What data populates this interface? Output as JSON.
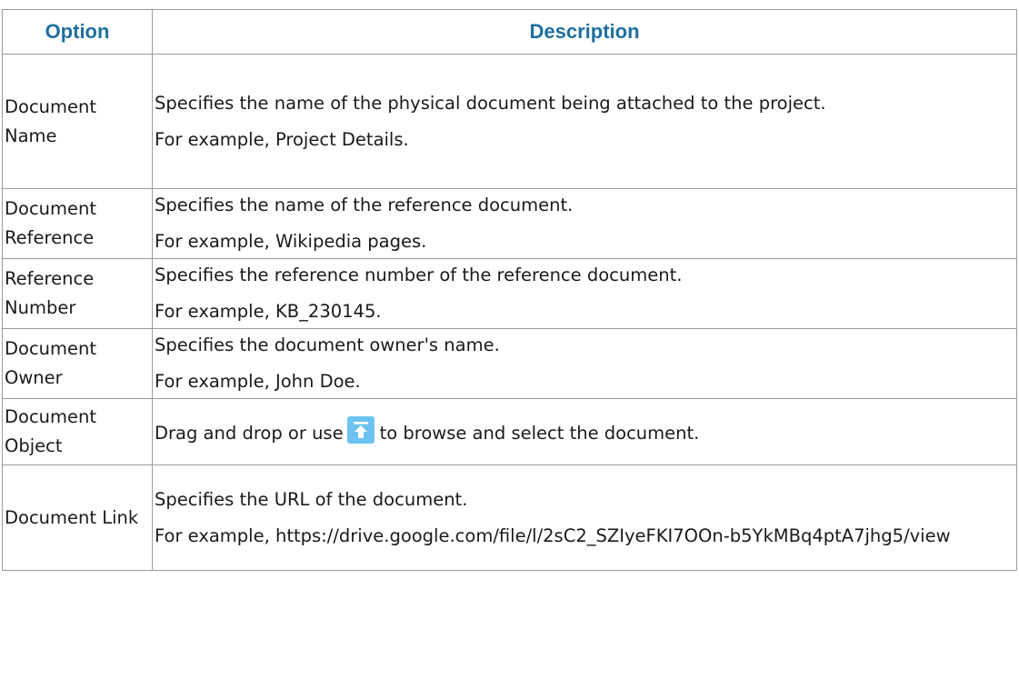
{
  "table": {
    "headers": {
      "option": "Option",
      "description": "Description"
    },
    "rows": [
      {
        "option": "Document Name",
        "description": "Specifies the name of the physical document being attached to the project.",
        "example": "For example, Project Details."
      },
      {
        "option": "Document Reference",
        "description": "Specifies the name of the reference document.",
        "example": "For example, Wikipedia pages."
      },
      {
        "option": "Reference Number",
        "description": "Specifies the reference number of the reference document.",
        "example": "For example, KB_230145."
      },
      {
        "option": "Document Owner",
        "description": "Specifies the document owner's name.",
        "example": "For example, John Doe."
      },
      {
        "option": "Document Object",
        "description_before_icon": "Drag and drop or use",
        "icon": "upload-icon",
        "description_after_icon": "to browse and select the document."
      },
      {
        "option": "Document Link",
        "description": "Specifies the URL of the document.",
        "example": "For example, https://drive.google.com/file/l/2sC2_SZIyeFKI7OOn-b5YkMBq4ptA7jhg5/view"
      }
    ]
  },
  "colors": {
    "header_text": "#1f6f9e",
    "border": "#9a9a9a",
    "icon_bg": "#6cc3f0"
  }
}
